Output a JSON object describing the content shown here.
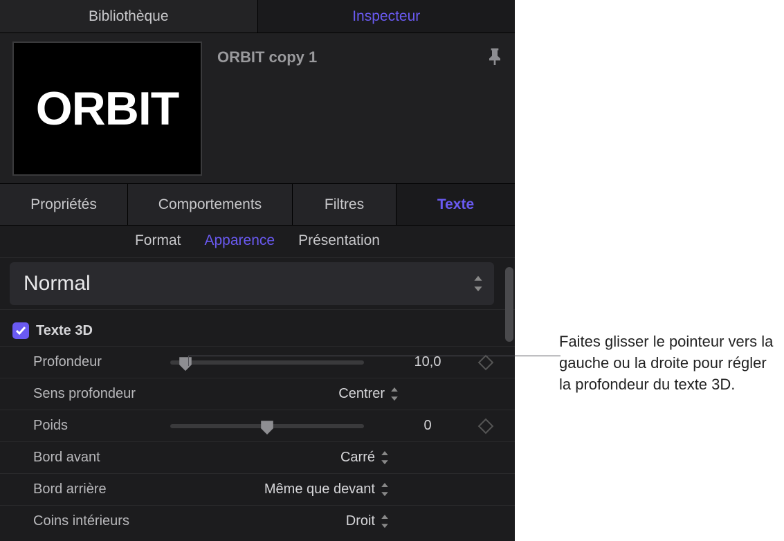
{
  "top_tabs": {
    "library": "Bibliothèque",
    "inspector": "Inspecteur"
  },
  "header": {
    "title": "ORBIT  copy 1",
    "thumb_text": "ORBIT"
  },
  "sub_tabs": {
    "properties": "Propriétés",
    "behaviors": "Comportements",
    "filters": "Filtres",
    "text": "Texte"
  },
  "text_subtabs": {
    "format": "Format",
    "appearance": "Apparence",
    "layout": "Présentation"
  },
  "style_popup": "Normal",
  "section": {
    "title": "Texte 3D",
    "checked": true
  },
  "params": {
    "depth": {
      "label": "Profondeur",
      "value": "10,0",
      "pos": 0.08
    },
    "depth_dir": {
      "label": "Sens profondeur",
      "value": "Centrer"
    },
    "weight": {
      "label": "Poids",
      "value": "0",
      "pos": 0.5
    },
    "front_edge": {
      "label": "Bord avant",
      "value": "Carré"
    },
    "back_edge": {
      "label": "Bord arrière",
      "value": "Même que devant"
    },
    "inside_corners": {
      "label": "Coins intérieurs",
      "value": "Droit"
    }
  },
  "callout": "Faites glisser le pointeur vers la gauche ou la droite pour régler la profondeur du texte 3D."
}
